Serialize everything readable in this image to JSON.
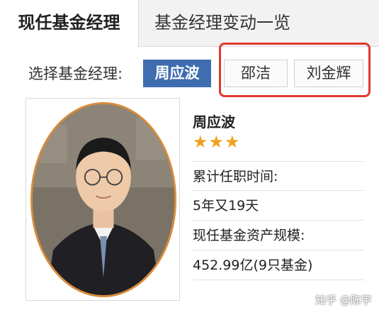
{
  "tabs": [
    {
      "label": "现任基金经理",
      "active": true
    },
    {
      "label": "基金经理变动一览",
      "active": false
    }
  ],
  "selector": {
    "label": "选择基金经理:",
    "managers": [
      {
        "label": "周应波",
        "selected": true
      },
      {
        "label": "邵洁",
        "selected": false
      },
      {
        "label": "刘金辉",
        "selected": false
      }
    ]
  },
  "profile": {
    "name": "周应波",
    "stars": "★★★",
    "rating": 3,
    "tenure_label": "累计任职时间:",
    "tenure_value": "5年又19天",
    "assets_label": "现任基金资产规模:",
    "assets_value": "452.99亿(9只基金)"
  },
  "watermark": "知乎 @陈宇",
  "colors": {
    "accent": "#3f6db0",
    "highlight": "#e03a2f",
    "star": "#f0a020"
  }
}
